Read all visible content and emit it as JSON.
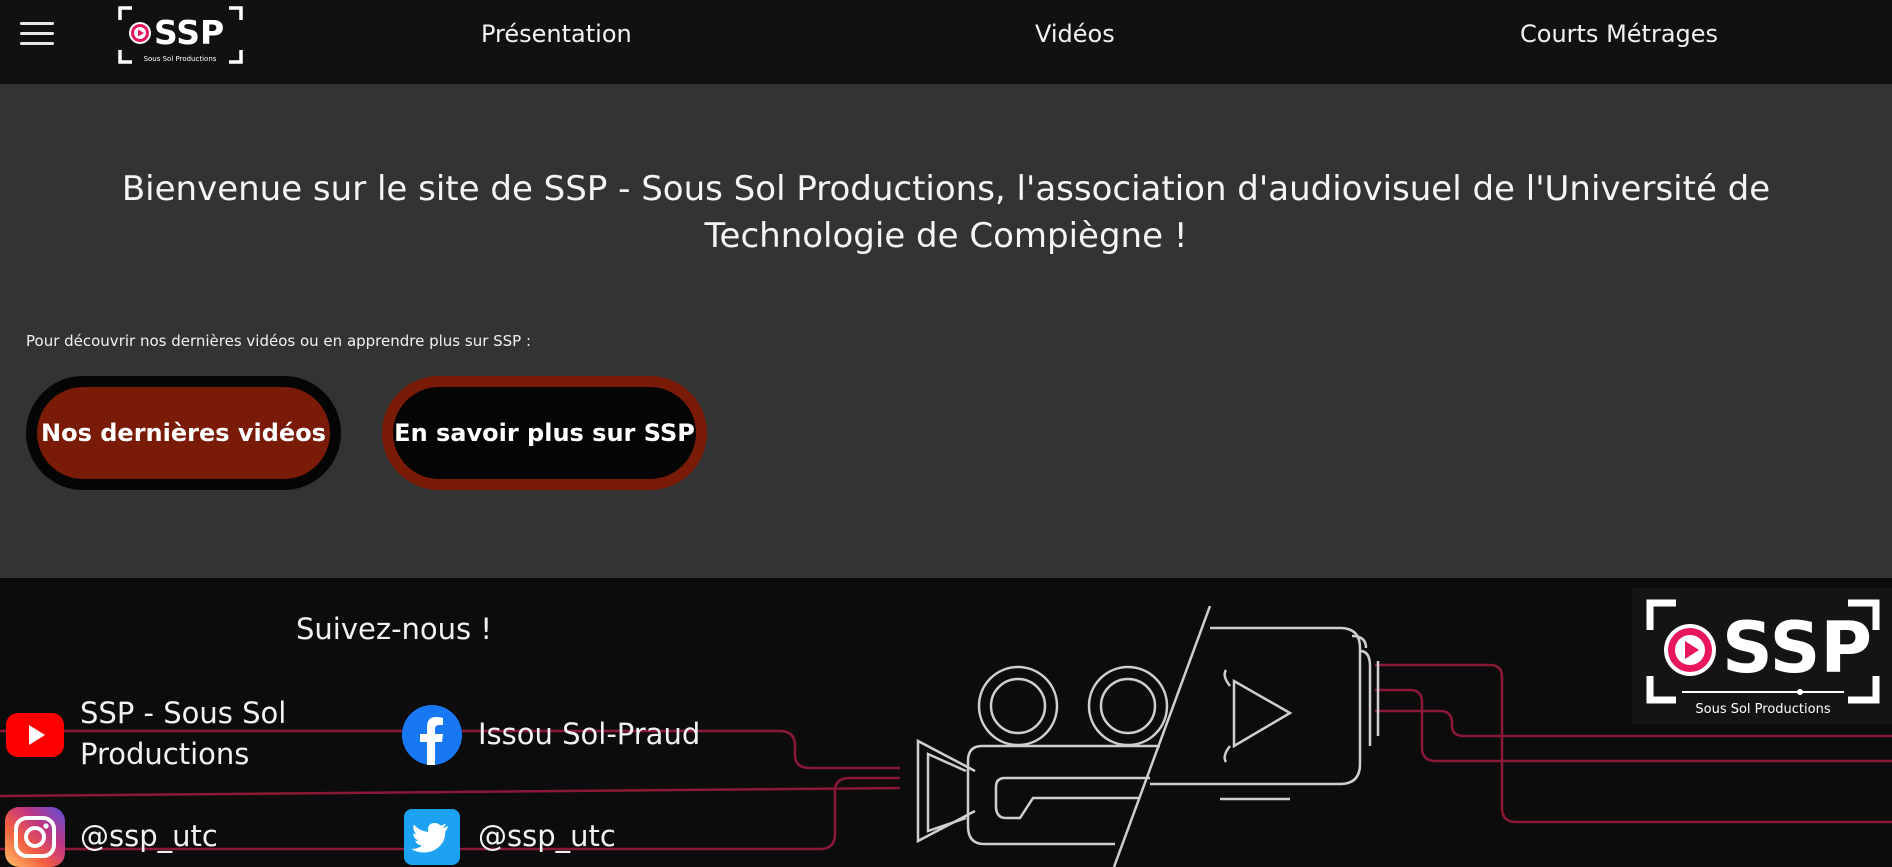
{
  "header": {
    "logo": {
      "text": "SSP",
      "subtitle": "Sous Sol Productions"
    },
    "nav": [
      "Présentation",
      "Vidéos",
      "Courts Métrages"
    ]
  },
  "main": {
    "welcome": "Bienvenue sur le site de SSP - Sous Sol Productions, l'association d'audiovisuel de l'Université de Technologie de Compiègne !",
    "intro": "Pour découvrir nos dernières vidéos ou en apprendre plus sur SSP :",
    "buttons": {
      "videos": "Nos dernières vidéos",
      "about": "En savoir plus sur SSP"
    }
  },
  "footer": {
    "follow_title": "Suivez-nous !",
    "social": {
      "youtube": "SSP - Sous Sol Productions",
      "facebook": "Issou Sol-Praud",
      "instagram": "@ssp_utc",
      "twitter": "@ssp_utc"
    },
    "logo": {
      "text": "SSP",
      "subtitle": "Sous Sol Productions"
    }
  },
  "colors": {
    "header_bg": "#111111",
    "main_bg": "#333333",
    "footer_bg": "#0c0c0c",
    "accent_red": "#7a1b08",
    "logo_pink": "#e8175d",
    "circuit_line": "#8b1836"
  },
  "icons": [
    "menu-icon",
    "youtube-icon",
    "facebook-icon",
    "instagram-icon",
    "twitter-icon",
    "camera-illustration"
  ]
}
